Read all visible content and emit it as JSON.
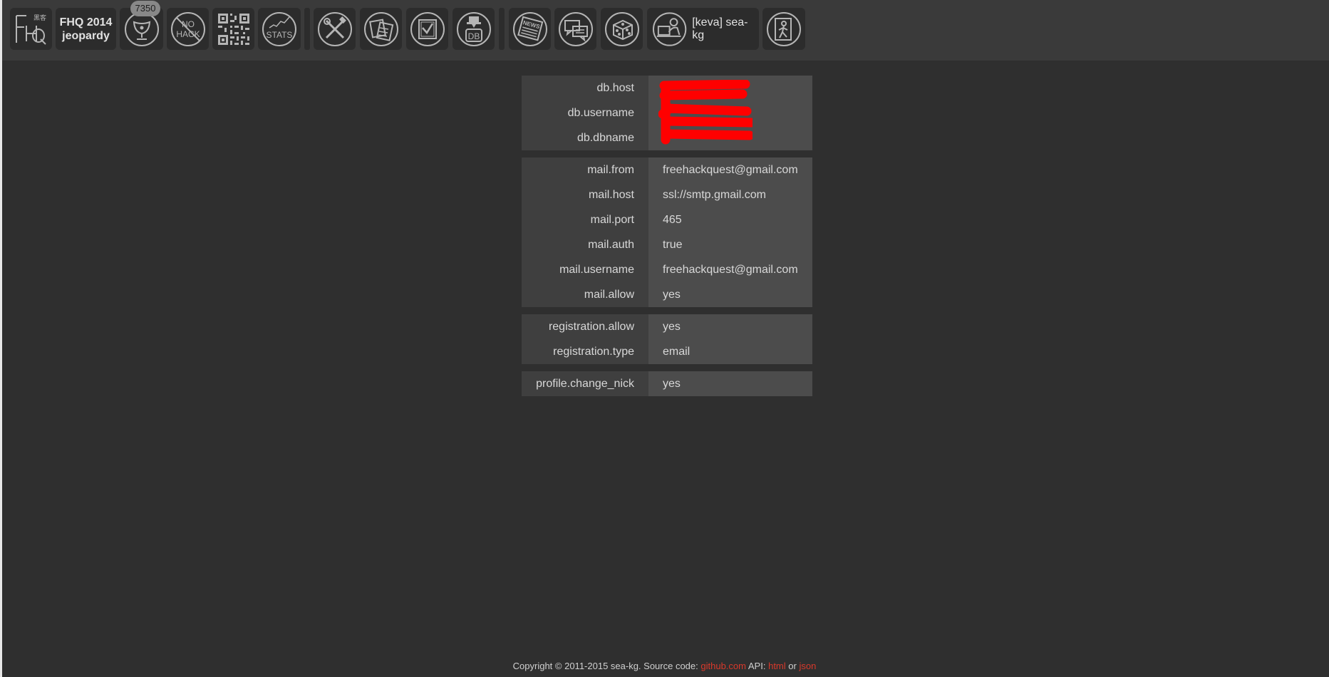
{
  "header": {
    "brand_line1": "FHQ 2014",
    "brand_line2": "jeopardy",
    "score_badge": "7350",
    "nohack_line1": "NO",
    "nohack_line2": "HACK",
    "stats_label": "STATS",
    "db_label": "DB",
    "news_label": "NEWS",
    "user_label": "[keva] sea-kg",
    "icons": [
      "fhq-logo-icon",
      "trophy-icon",
      "no-hack-icon",
      "qr-code-icon",
      "stats-icon",
      "tools-icon",
      "documents-icon",
      "checklist-icon",
      "database-icon",
      "news-icon",
      "chat-icon",
      "dice-icon",
      "user-profile-icon",
      "logout-icon"
    ]
  },
  "settings": {
    "groups": [
      {
        "rows": [
          {
            "key": "db.host",
            "value": ""
          },
          {
            "key": "db.username",
            "value": ""
          },
          {
            "key": "db.dbname",
            "value": ""
          }
        ]
      },
      {
        "rows": [
          {
            "key": "mail.from",
            "value": "freehackquest@gmail.com"
          },
          {
            "key": "mail.host",
            "value": "ssl://smtp.gmail.com"
          },
          {
            "key": "mail.port",
            "value": "465"
          },
          {
            "key": "mail.auth",
            "value": "true"
          },
          {
            "key": "mail.username",
            "value": "freehackquest@gmail.com"
          },
          {
            "key": "mail.allow",
            "value": "yes"
          }
        ]
      },
      {
        "rows": [
          {
            "key": "registration.allow",
            "value": "yes"
          },
          {
            "key": "registration.type",
            "value": "email"
          }
        ]
      },
      {
        "rows": [
          {
            "key": "profile.change_nick",
            "value": "yes"
          }
        ]
      }
    ]
  },
  "footer": {
    "copyright": "Copyright © 2011-2015 sea-kg. Source code:",
    "github_link": "github.com",
    "api_label": "API:",
    "html_link": "html",
    "or_label": "or",
    "json_link": "json"
  },
  "colors": {
    "background": "#2f2f2f",
    "topbar": "#3a3a3a",
    "link": "#d9392b",
    "redaction": "#ff0000"
  }
}
